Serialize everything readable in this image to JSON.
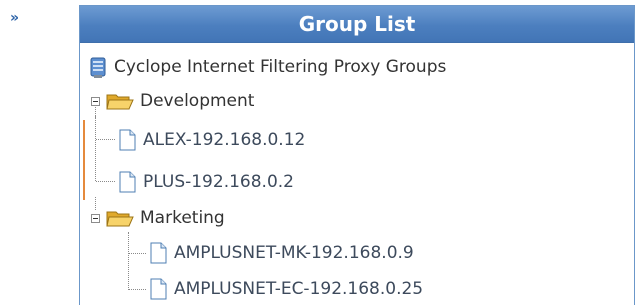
{
  "sidebar": {
    "collapse_label": "»"
  },
  "panel": {
    "title": "Group List"
  },
  "tree": {
    "root_label": "Cyclope Internet Filtering Proxy Groups",
    "groups": [
      {
        "label": "Development",
        "items": [
          "ALEX-192.168.0.12",
          "PLUS-192.168.0.2"
        ]
      },
      {
        "label": "Marketing",
        "items": [
          "AMPLUSNET-MK-192.168.0.9",
          "AMPLUSNET-EC-192.168.0.25"
        ]
      }
    ]
  },
  "colors": {
    "header_background": "#4c7fbf",
    "header_text": "#ffffff",
    "folder": "#f2c94c",
    "selection_marker": "#e58a3c",
    "link_blue": "#2d63a8"
  },
  "icons": {
    "root": "server-icon",
    "group": "folder-open-icon",
    "item": "document-icon",
    "expander": "minus-box-icon"
  }
}
